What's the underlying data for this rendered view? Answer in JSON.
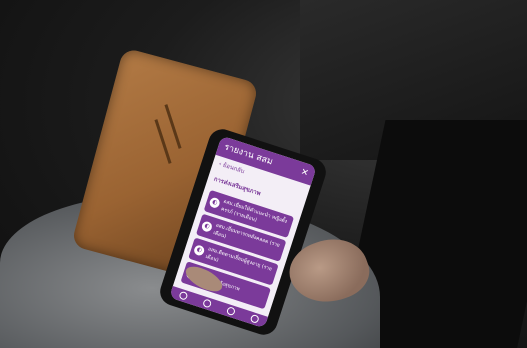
{
  "photo": {
    "scene": "phone-in-leather-flip-case",
    "screen_ui": {
      "header_title": "รายงาน สสม",
      "header_close": "✕",
      "back_label": "‹ ย้อนกลับ",
      "section_heading": "การส่งเสริมสุขภาพ",
      "items": [
        "อสม.เยี่ยมให้คำแนะนำ หญิงตั้งครรภ์ (รายเดือน)",
        "อสม.เยี่ยมทารกหลังคลอด (รายเดือน)",
        "อสม.ติดตามเยี่ยมผู้สูงอายุ (รายเดือน)",
        "การเฝ้าระวังสุขภาพ"
      ],
      "accent_color": "#7b3a9a"
    }
  }
}
